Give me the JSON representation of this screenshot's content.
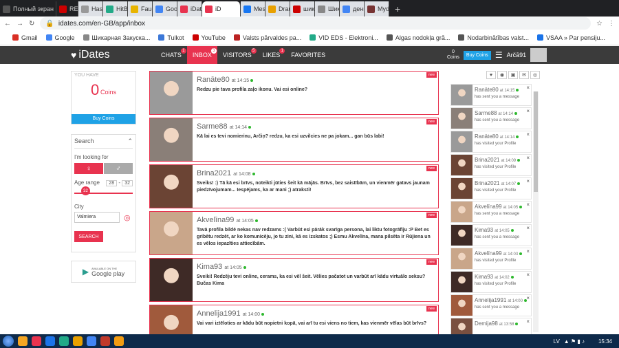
{
  "browser": {
    "tabs": [
      {
        "label": "Полный экран",
        "color": "#555"
      },
      {
        "label": "REC",
        "color": "#c00"
      },
      {
        "label": "Hash",
        "color": "#999"
      },
      {
        "label": "HitBt",
        "color": "#2a8"
      },
      {
        "label": "Fauce",
        "color": "#e8b400"
      },
      {
        "label": "Goog",
        "color": "#4285f4"
      },
      {
        "label": "iDate",
        "color": "#e8334f"
      },
      {
        "label": "iD",
        "color": "#e8334f"
      },
      {
        "label": "Mess",
        "color": "#1877f2"
      },
      {
        "label": "Draug",
        "color": "#e8a000"
      },
      {
        "label": "шикар",
        "color": "#c00"
      },
      {
        "label": "Шика",
        "color": "#888"
      },
      {
        "label": "деньг",
        "color": "#4285f4"
      },
      {
        "label": "Mydo",
        "color": "#733"
      }
    ],
    "url": "idates.com/en-GB/app/inbox",
    "bookmarks": [
      "Gmail",
      "Google",
      "Шикарная Закуска...",
      "Tulkot",
      "YouTube",
      "Valsts pārvaldes pa...",
      "VID EDS - Elektroni...",
      "Algas nodokļa grā...",
      "Nodarbinātības valst...",
      "VSAA » Par pensiju..."
    ]
  },
  "header": {
    "logo": "iDates",
    "nav": [
      {
        "label": "CHATS",
        "badge": "1"
      },
      {
        "label": "INBOX",
        "badge": "3"
      },
      {
        "label": "VISITORS",
        "badge": "5"
      },
      {
        "label": "LIKES",
        "badge": "1"
      },
      {
        "label": "FAVORITES",
        "badge": ""
      }
    ],
    "coins_count": "0",
    "coins_label": "Coins",
    "buy": "Buy Coins",
    "username": "Arčā91"
  },
  "left": {
    "you_have": "YOU HAVE",
    "coins": "0",
    "coins_label": "Coins",
    "buy": "Buy Coins",
    "search_title": "Search",
    "looking_for": "I'm looking for",
    "age_range": "Age range",
    "age_min": "28",
    "age_max": "32",
    "age_knob": "32",
    "city_label": "City",
    "city_value": "Valmiera",
    "search_btn": "SEARCH",
    "gp_small": "AVAILABLE ON THE",
    "gp": "Google play"
  },
  "messages": [
    {
      "name": "Ranāte80",
      "time": "at 14:15",
      "text": "Redzu pie tava profila zaļo ikonu. Vai esi online?",
      "tag": "new",
      "photo": "#9a9a9a"
    },
    {
      "name": "Sarme88",
      "time": "at 14:14",
      "text": "Kā lai es tevi nomierinu, Arčiņ? redzu, ka esi uzvilcies ne pa jokam... gan būs labi!",
      "tag": "new",
      "photo": "#8a7f78"
    },
    {
      "name": "Brina2021",
      "time": "at 14:08",
      "text": "Sveiks! :) Tā kā esi brīvs, noteikti jūties šeit kā mājās. Brīvs, bez saistībām, un vienmēr gatavs jaunam piedzīvojumam... Iespējams, ka ar mani ;) atraksti!",
      "tag": "new",
      "photo": "#6b4434"
    },
    {
      "name": "Akvelīna99",
      "time": "at 14:05",
      "text": "Tavā profila bildē nekas nav redzams :( Varbūt esi pārāk svarīga persona, lai liktu fotogrāfiju :P Bet es gribētu redzēt, ar ko komunicēju, jo tu zini, kā es izskatos ;) Esmu Akvelīna, mana pilsēta ir Rūjiena un es vēlos iepazīties attiecībām.",
      "tag": "new",
      "photo": "#c9a68a"
    },
    {
      "name": "Kima93",
      "time": "at 14:05",
      "text": "Sveiki! Redzēju tevi online, cerams, ka esi vēl šeit. Vēlies pačatot un varbūt arī kādu virtuālo seksu? Bučas Kima",
      "tag": "new",
      "photo": "#3e2a26"
    },
    {
      "name": "Annelija1991",
      "time": "at 14:00",
      "text": "Vai vari iztēloties ar kādu būt nopietni kopā, vai arī tu esi viens no tiem, kas vienmēr vēlas būt brīvs?",
      "tag": "new",
      "photo": "#a05a3c"
    }
  ],
  "activity": [
    {
      "name": "Ranāte80",
      "time": "at 14:15",
      "action": "has sent you a message",
      "photo": "#9a9a9a"
    },
    {
      "name": "Sarme88",
      "time": "at 14:14",
      "action": "has sent you a message",
      "photo": "#8a7f78"
    },
    {
      "name": "Ranāte80",
      "time": "at 14:14",
      "action": "has visited your Profile",
      "photo": "#9a9a9a"
    },
    {
      "name": "Brina2021",
      "time": "at 14:09",
      "action": "has visited your Profile",
      "photo": "#6b4434"
    },
    {
      "name": "Brina2021",
      "time": "at 14:07",
      "action": "has visited your Profile",
      "photo": "#6b4434"
    },
    {
      "name": "Akvelīna99",
      "time": "at 14:05",
      "action": "has sent you a message",
      "photo": "#c9a68a"
    },
    {
      "name": "Kima93",
      "time": "at 14:05",
      "action": "has sent you a message",
      "photo": "#3e2a26"
    },
    {
      "name": "Akvelīna99",
      "time": "at 14:03",
      "action": "has visited your Profile",
      "photo": "#c9a68a"
    },
    {
      "name": "Kima93",
      "time": "at 14:02",
      "action": "has visited your Profile",
      "photo": "#3e2a26"
    },
    {
      "name": "Annelija1991",
      "time": "at 14:00",
      "action": "has sent you a message",
      "photo": "#a05a3c"
    },
    {
      "name": "Demija98",
      "time": "at 13:58",
      "action": "",
      "photo": "#7a5040"
    }
  ],
  "taskbar": {
    "lang": "LV",
    "time": "15:34"
  },
  "colors": {
    "accent": "#e8334f",
    "blue": "#1fa2e6",
    "dark": "#3b3b3b"
  }
}
